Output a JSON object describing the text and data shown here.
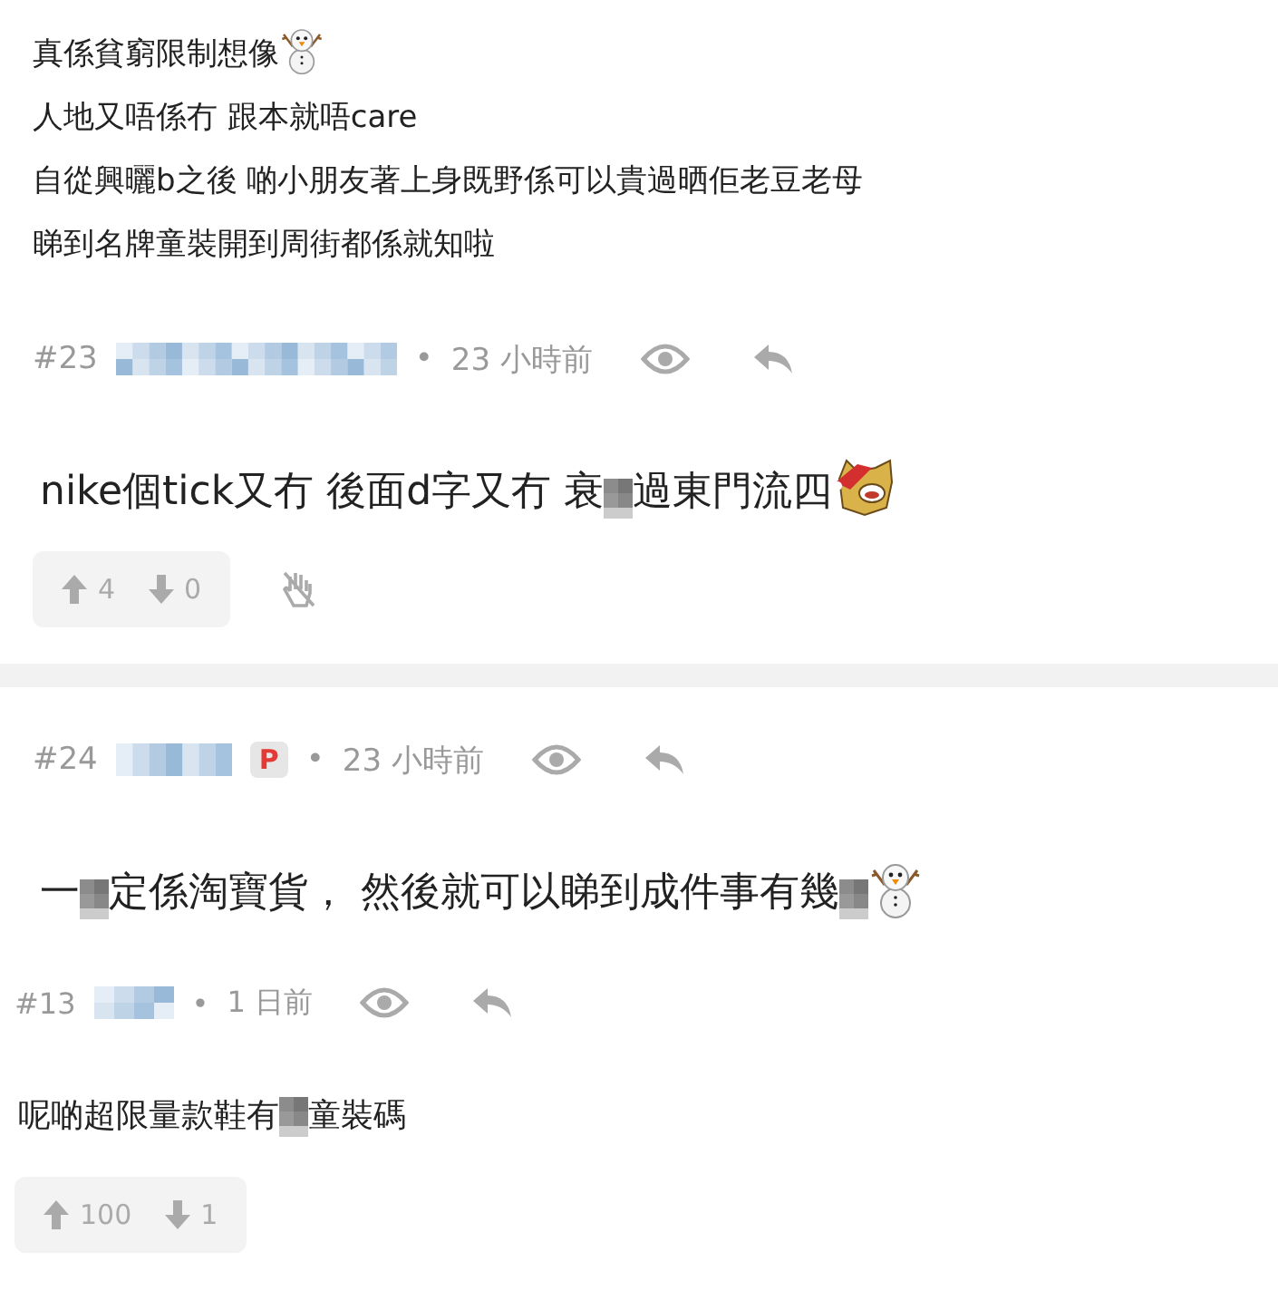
{
  "top_post_tail": {
    "lines": [
      [
        {
          "kind": "text",
          "text": "真係貧窮限制想像"
        },
        {
          "kind": "snowman"
        }
      ],
      [
        {
          "kind": "text",
          "text": "人地又唔係冇 跟本就唔care"
        }
      ],
      [
        {
          "kind": "text",
          "text": "自從興曬b之後 啲小朋友著上身既野係可以貴過晒佢老豆老母"
        }
      ],
      [
        {
          "kind": "text",
          "text": "睇到名牌童裝開到周街都係就知啦"
        }
      ]
    ]
  },
  "reply_23": {
    "number": "#23",
    "separator": "•",
    "time": "23 小時前",
    "body": [
      {
        "kind": "text",
        "text": "nike個tick又冇 後面d字又冇 衰"
      },
      {
        "kind": "censor"
      },
      {
        "kind": "text",
        "text": "過東門流四"
      },
      {
        "kind": "dog"
      }
    ],
    "votes": {
      "up": "4",
      "down": "0"
    }
  },
  "reply_24": {
    "number": "#24",
    "badge": "P",
    "separator": "•",
    "time": "23 小時前",
    "body": [
      {
        "kind": "text",
        "text": "一"
      },
      {
        "kind": "censor"
      },
      {
        "kind": "text",
        "text": "定係淘寶貨， 然後就可以睇到成件事有幾"
      },
      {
        "kind": "censor"
      },
      {
        "kind": "snowman"
      }
    ],
    "quote": {
      "number": "#13",
      "separator": "•",
      "time": "1 日前",
      "body": [
        {
          "kind": "text",
          "text": "呢啲超限量款鞋有"
        },
        {
          "kind": "censor"
        },
        {
          "kind": "text",
          "text": "童裝碼"
        }
      ],
      "votes": {
        "up": "100",
        "down": "1"
      }
    }
  }
}
